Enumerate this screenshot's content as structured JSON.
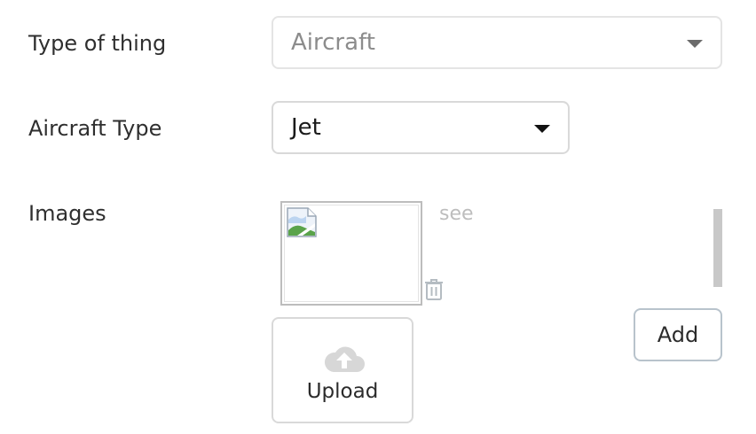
{
  "form": {
    "type_of_thing": {
      "label": "Type of thing",
      "value": "Aircraft"
    },
    "aircraft_type": {
      "label": "Aircraft Type",
      "value": "Jet"
    },
    "images": {
      "label": "Images",
      "see_link": "see",
      "thumbnail_icon": "broken-image-icon",
      "delete_icon": "trash-icon"
    },
    "add_button": "Add",
    "upload": {
      "label": "Upload",
      "icon": "cloud-upload-icon"
    }
  },
  "colors": {
    "border": "#d9d9d9",
    "disabled_text": "#8c8c8c",
    "muted_link": "#bdbdbd",
    "add_button_border": "#b8c3cc"
  }
}
